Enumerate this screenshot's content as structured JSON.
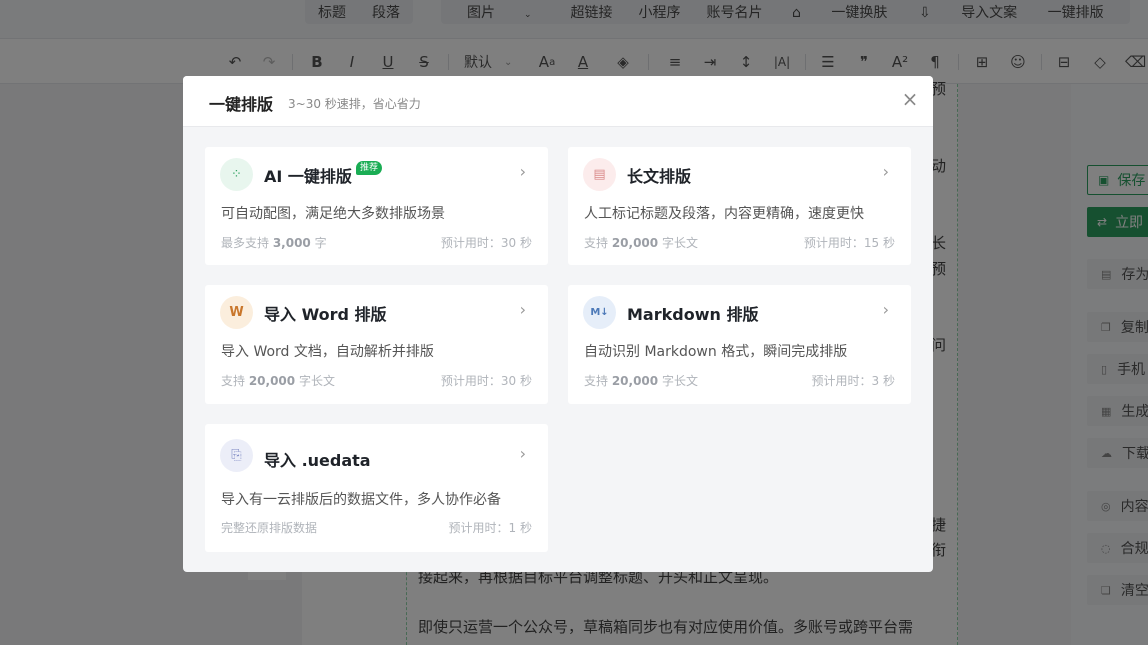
{
  "topbar": {
    "items": [
      "标题",
      "段落",
      "图片",
      "超链接",
      "小程序",
      "账号名片",
      "一键换肤",
      "导入文案",
      "一键排版"
    ],
    "caret": "⌄"
  },
  "toolbar": {
    "undo": "↶",
    "redo": "↷",
    "bold": "B",
    "italic": "I",
    "underline": "U",
    "strike": "S",
    "font_select": "默认",
    "font_caret": "⌄"
  },
  "editor": {
    "edge_chars": [
      "预",
      "动",
      "长",
      "预",
      "问",
      "捷",
      "衔"
    ],
    "para1": "接起来，再根据目标平台调整标题、开头和正文呈现。",
    "para2": "即使只运营一个公众号，草稿箱同步也有对应使用价值。多账号或跨平台需"
  },
  "right_panel": {
    "save": "保存",
    "now": "立即",
    "items": [
      "存为",
      "复制",
      "手机",
      "生成",
      "下载",
      "内容",
      "合规",
      "清空"
    ]
  },
  "modal": {
    "title": "一键排版",
    "subtitle": "3~30 秒速排，省心省力",
    "close": "×",
    "cards": [
      {
        "title": "AI 一键排版",
        "badge": "推荐",
        "desc": "可自动配图，满足绝大多数排版场景",
        "meta_prefix": "最多支持 ",
        "meta_bold": "3,000",
        "meta_suffix": " 字",
        "time": "预计用时：30 秒",
        "icon_glyph": "⁘",
        "icon_color": "#2da160",
        "icon_bg": "#e8f6ee"
      },
      {
        "title": "长文排版",
        "desc": "人工标记标题及段落，内容更精确，速度更快",
        "meta_prefix": "支持 ",
        "meta_bold": "20,000",
        "meta_suffix": " 字长文",
        "time": "预计用时：15 秒",
        "icon_glyph": "▤",
        "icon_color": "#d98a8a",
        "icon_bg": "#fcecec"
      },
      {
        "title": "导入 Word 排版",
        "desc": "导入 Word 文档，自动解析并排版",
        "meta_prefix": "支持 ",
        "meta_bold": "20,000",
        "meta_suffix": " 字长文",
        "time": "预计用时：30 秒",
        "icon_glyph": "W",
        "icon_color": "#c9772c",
        "icon_bg": "#fbeedd"
      },
      {
        "title": "Markdown 排版",
        "desc": "自动识别 Markdown 格式，瞬间完成排版",
        "meta_prefix": "支持 ",
        "meta_bold": "20,000",
        "meta_suffix": " 字长文",
        "time": "预计用时：3 秒",
        "icon_glyph": "M↓",
        "icon_color": "#4c79b8",
        "icon_bg": "#e6eef9"
      },
      {
        "title": "导入 .uedata",
        "desc": "导入有一云排版后的数据文件，多人协作必备",
        "meta_prefix": "完整还原排版数据",
        "meta_bold": "",
        "meta_suffix": "",
        "time": "预计用时：1 秒",
        "icon_glyph": "⎘",
        "icon_color": "#7b86c2",
        "icon_bg": "#eceef8"
      }
    ]
  }
}
